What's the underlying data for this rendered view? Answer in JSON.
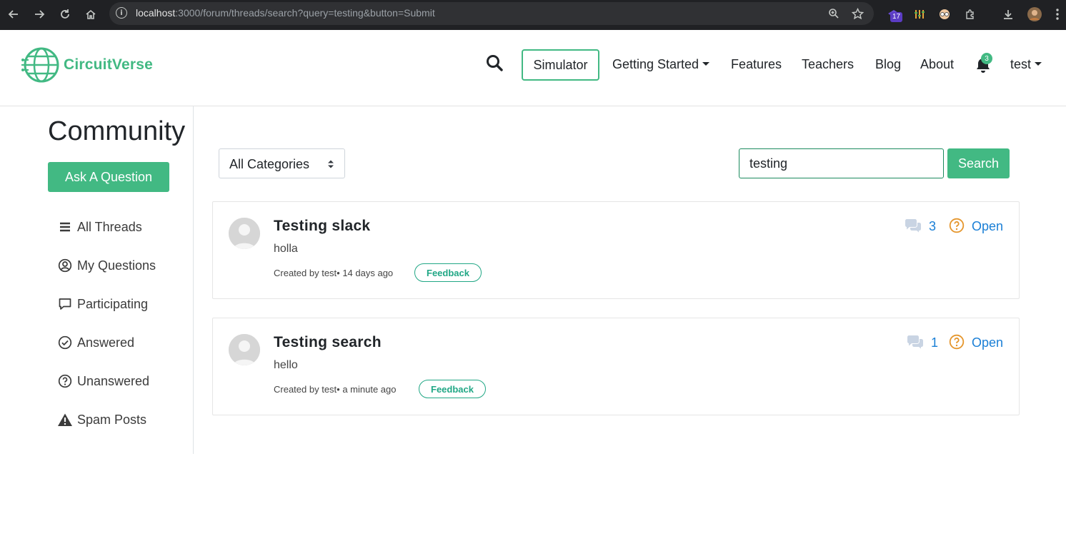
{
  "browser": {
    "url_host": "localhost",
    "url_rest": ":3000/forum/threads/search?query=testing&button=Submit",
    "extension_badge": "17"
  },
  "navbar": {
    "brand": "CircuitVerse",
    "simulator": "Simulator",
    "getting_started": "Getting Started",
    "features": "Features",
    "teachers": "Teachers",
    "blog": "Blog",
    "about": "About",
    "notification_count": "3",
    "user": "test"
  },
  "sidebar": {
    "title": "Community",
    "ask_button": "Ask A Question",
    "items": [
      {
        "label": "All Threads",
        "icon": "list-icon"
      },
      {
        "label": "My Questions",
        "icon": "user-circle-icon"
      },
      {
        "label": "Participating",
        "icon": "comment-icon"
      },
      {
        "label": "Answered",
        "icon": "check-circle-icon"
      },
      {
        "label": "Unanswered",
        "icon": "question-circle-icon"
      },
      {
        "label": "Spam Posts",
        "icon": "warning-icon"
      }
    ]
  },
  "filters": {
    "category_selected": "All Categories",
    "search_value": "testing",
    "search_button": "Search"
  },
  "threads": [
    {
      "title": "Testing slack",
      "body": "holla",
      "meta": "Created by test• 14 days ago",
      "tag": "Feedback",
      "replies": "3",
      "status": "Open"
    },
    {
      "title": "Testing search",
      "body": "hello",
      "meta": "Created by test• a minute ago",
      "tag": "Feedback",
      "replies": "1",
      "status": "Open"
    }
  ],
  "colors": {
    "brand": "#42b983",
    "link": "#1a7fd6",
    "status_icon": "#e5962d",
    "tag": "#21a785"
  }
}
